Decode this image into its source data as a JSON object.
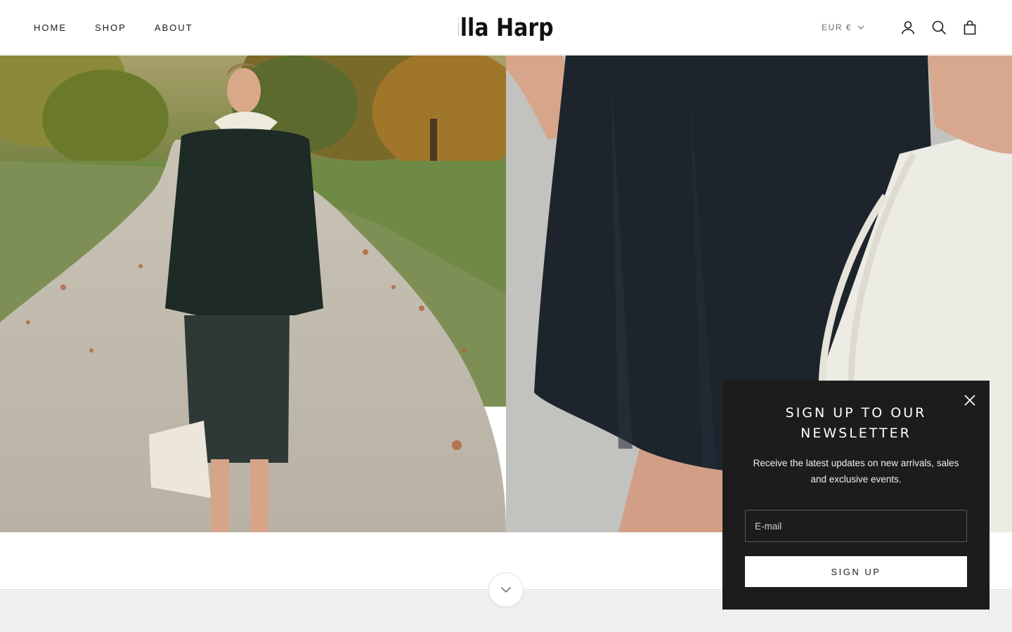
{
  "header": {
    "nav": [
      "HOME",
      "SHOP",
      "ABOUT"
    ],
    "brand": "Villa Harpel",
    "currency": "EUR €",
    "icons": [
      "account-icon",
      "search-icon",
      "cart-icon"
    ]
  },
  "popup": {
    "title": "SIGN UP TO OUR NEWSLETTER",
    "text": "Receive the latest updates on new arrivals, sales and exclusive events.",
    "email_placeholder": "E-mail",
    "button": "SIGN UP"
  },
  "colors": {
    "popup_bg": "#1c1c1c",
    "band_grey": "#efefef"
  }
}
